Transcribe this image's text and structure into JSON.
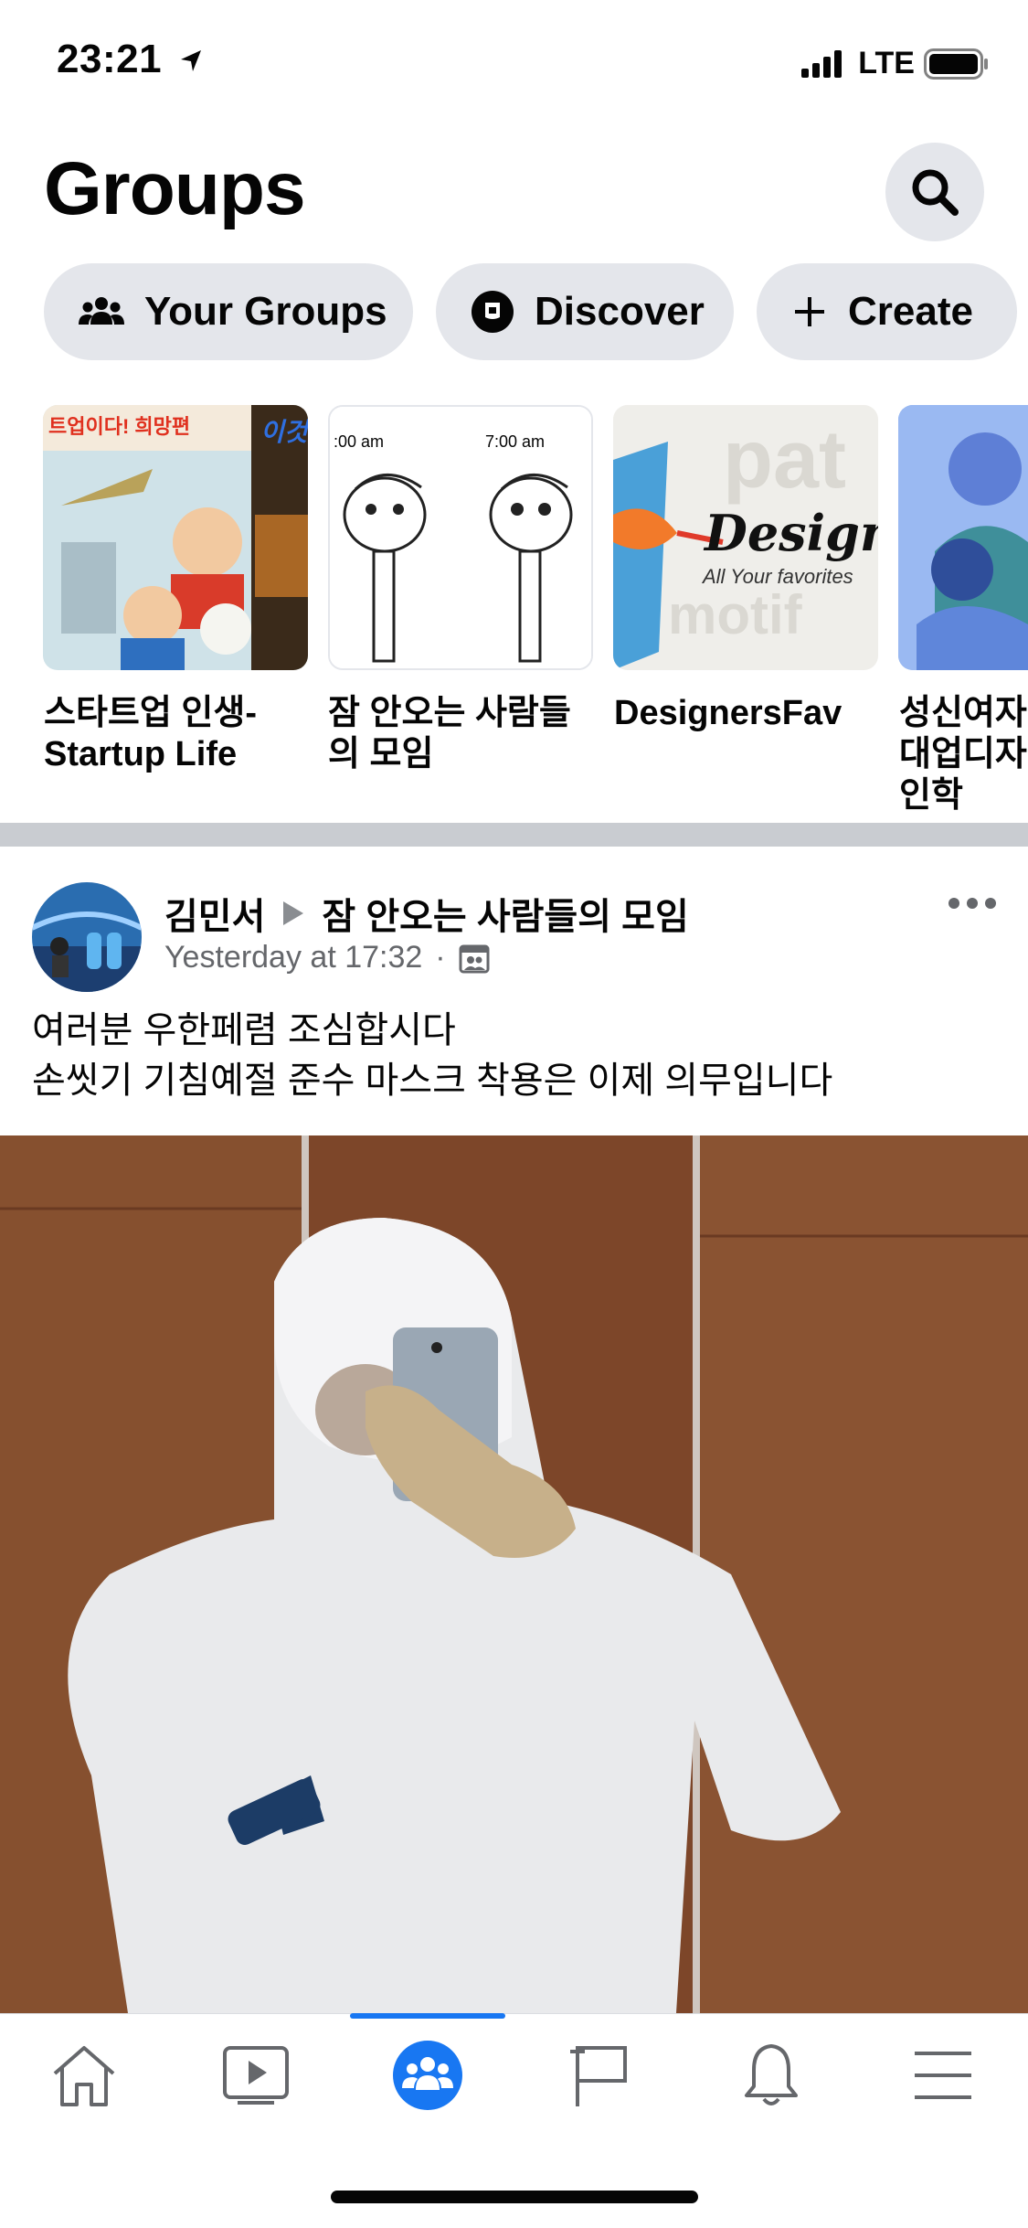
{
  "status_bar": {
    "time": "23:21",
    "network": "LTE"
  },
  "header": {
    "title": "Groups",
    "search_icon": "search-icon"
  },
  "chips": [
    {
      "label": "Your Groups",
      "icon": "groups-icon"
    },
    {
      "label": "Discover",
      "icon": "discover-icon"
    },
    {
      "label": "Create",
      "icon": "plus-icon"
    }
  ],
  "groups": [
    {
      "name": "스타트업 인생-Startup Life",
      "thumb_text_1": "트업이다! 희망편",
      "thumb_text_2": "이것"
    },
    {
      "name": "잠 안오는 사람들의 모임",
      "thumb_text_1": ":00 am",
      "thumb_text_2": "7:00 am"
    },
    {
      "name": "DesignersFav",
      "thumb_text_1": "Designer",
      "thumb_text_2": "All Your favorites"
    },
    {
      "name": "성신여자대업디자인학"
    }
  ],
  "post": {
    "author": "김민서",
    "group": "잠 안오는 사람들의 모임",
    "time": "Yesterday at 17:32",
    "separator": "·",
    "text_line1": "여러분 우한페렴 조심합시다",
    "text_line2": "손씻기 기침예절 준수 마스크 착용은 이제 의무입니다"
  },
  "bottom_nav": [
    {
      "name": "home",
      "icon": "home-icon"
    },
    {
      "name": "watch",
      "icon": "video-icon"
    },
    {
      "name": "groups",
      "icon": "groups-icon",
      "active": true
    },
    {
      "name": "pages",
      "icon": "flag-icon"
    },
    {
      "name": "notifications",
      "icon": "bell-icon"
    },
    {
      "name": "menu",
      "icon": "menu-icon"
    }
  ],
  "colors": {
    "accent": "#1877f2",
    "chip_bg": "#e4e6eb",
    "secondary_text": "#65676b"
  }
}
